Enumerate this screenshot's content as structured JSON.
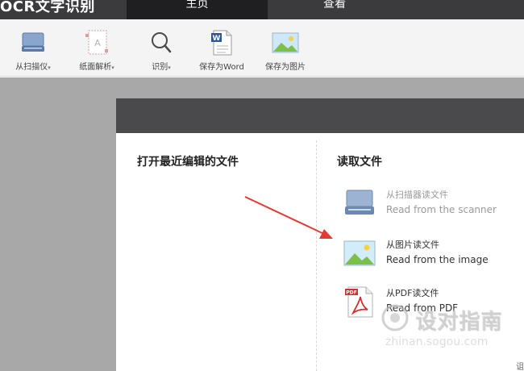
{
  "app": {
    "title": "OCR文字识别"
  },
  "tabs": [
    {
      "label": "主页"
    },
    {
      "label": "查看"
    }
  ],
  "toolbar": {
    "scan": {
      "label": "从扫描仪",
      "caret": "▾"
    },
    "paper": {
      "label": "纸面解析",
      "caret": "▾"
    },
    "ocr": {
      "label": "识别",
      "caret": "▾"
    },
    "save_word": {
      "label": "保存为Word"
    },
    "save_image": {
      "label": "保存为图片"
    }
  },
  "dialog": {
    "recent_title": "打开最近编辑的文件",
    "open_title": "读取文件",
    "options": [
      {
        "title": "从扫描器读文件",
        "subtitle": "Read from the scanner",
        "icon": "scanner-icon",
        "enabled": false
      },
      {
        "title": "从图片读文件",
        "subtitle": "Read from the image",
        "icon": "image-icon",
        "enabled": true
      },
      {
        "title": "从PDF读文件",
        "subtitle": "Read from PDF",
        "icon": "pdf-icon",
        "enabled": true
      }
    ]
  },
  "corner_text": "诅",
  "watermark": {
    "text": "设对指南",
    "url": "zhinan.sogou.com"
  },
  "colors": {
    "titlebar": "#3b3b3e",
    "active_tab": "#1f1f21",
    "toolbar": "#f4f4f4",
    "workspace": "#a8a8a8",
    "dialog_header": "#4a4a4d",
    "annotation_arrow": "#e53935"
  }
}
